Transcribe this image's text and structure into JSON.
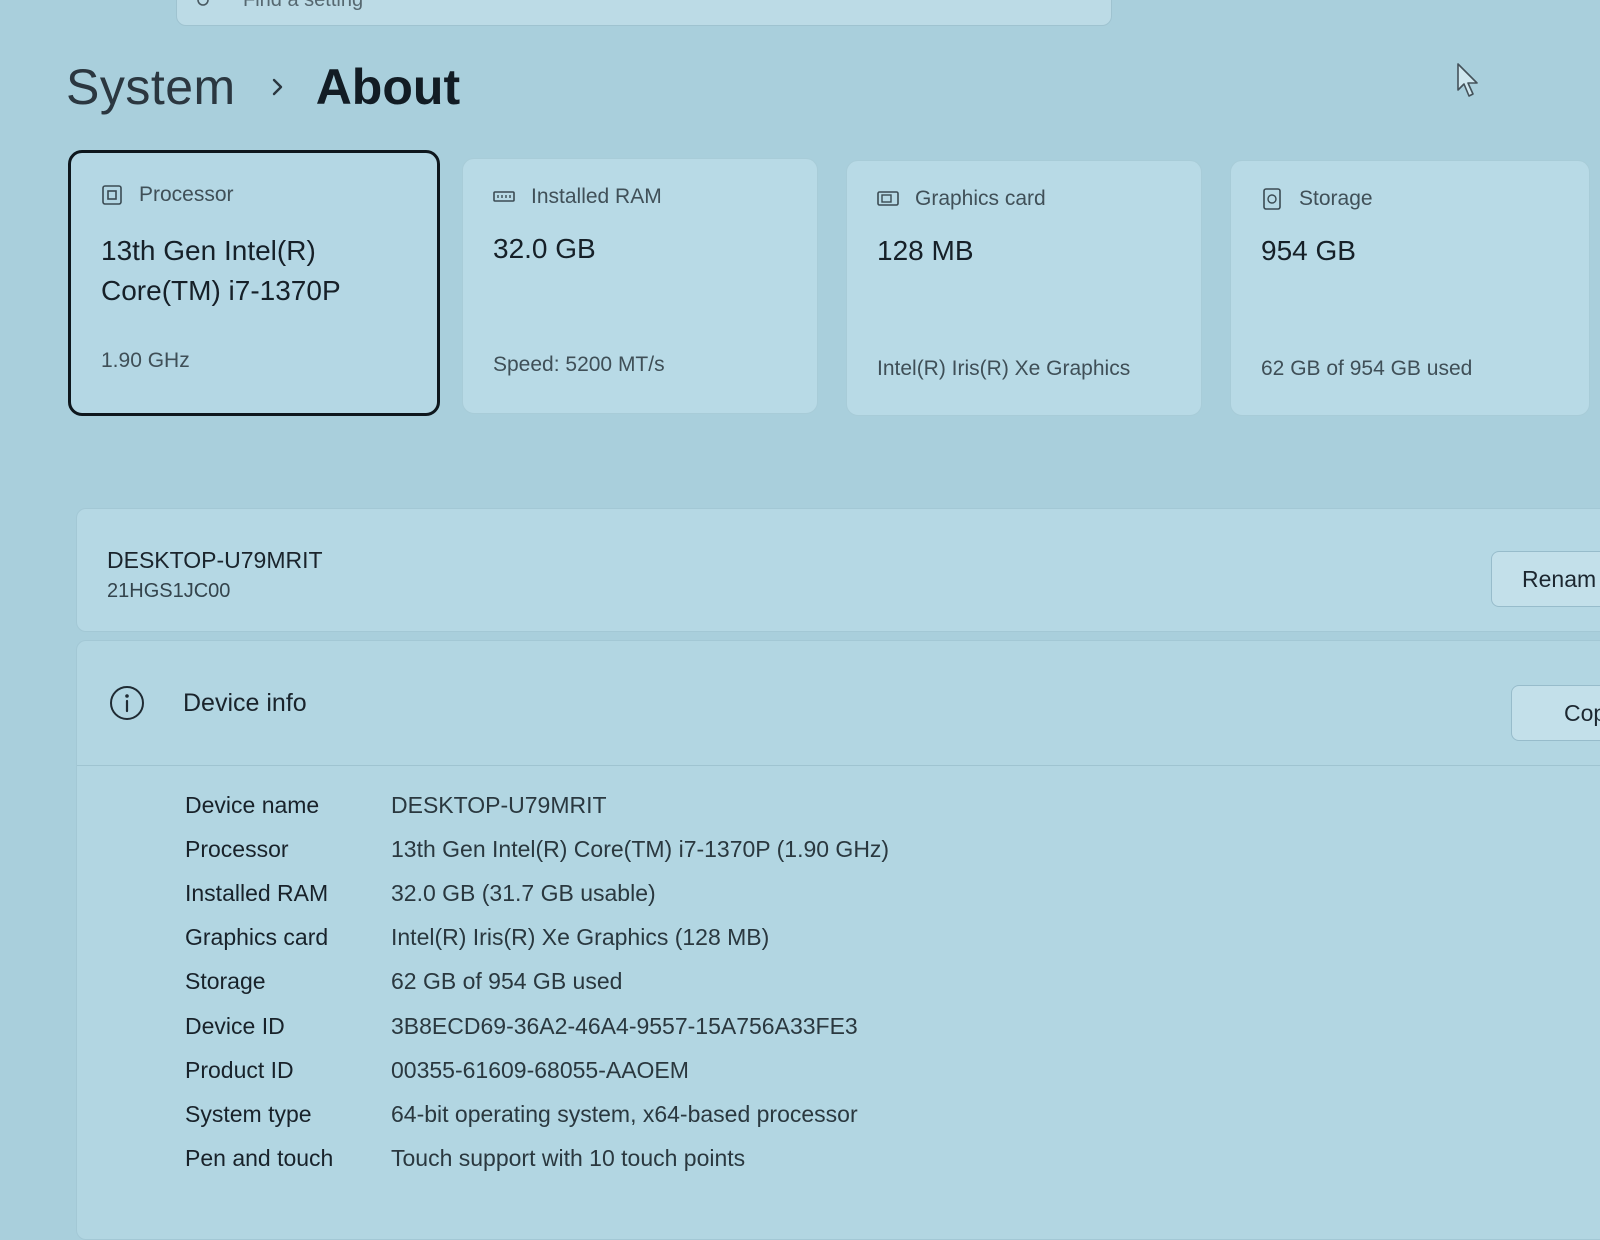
{
  "search": {
    "placeholder": "Find a setting"
  },
  "breadcrumb": {
    "parent": "System",
    "current": "About"
  },
  "cards": [
    {
      "id": "processor",
      "icon": "processor-icon",
      "label": "Processor",
      "value": "13th Gen Intel(R) Core(TM) i7-1370P",
      "sub": "1.90 GHz",
      "selected": true
    },
    {
      "id": "ram",
      "icon": "ram-icon",
      "label": "Installed RAM",
      "value": "32.0 GB",
      "sub": "Speed: 5200 MT/s",
      "selected": false
    },
    {
      "id": "graphics",
      "icon": "graphics-card-icon",
      "label": "Graphics card",
      "value": "128 MB",
      "sub": "Intel(R) Iris(R) Xe Graphics",
      "selected": false
    },
    {
      "id": "storage",
      "icon": "storage-icon",
      "label": "Storage",
      "value": "954 GB",
      "sub": "62 GB of 954 GB used",
      "selected": false
    }
  ],
  "device": {
    "name": "DESKTOP-U79MRIT",
    "model": "21HGS1JC00",
    "rename_label": "Renam"
  },
  "device_info": {
    "title": "Device info",
    "copy_label": "Cop",
    "specs": [
      {
        "key": "Device name",
        "value": "DESKTOP-U79MRIT"
      },
      {
        "key": "Processor",
        "value": "13th Gen Intel(R) Core(TM) i7-1370P (1.90 GHz)"
      },
      {
        "key": "Installed RAM",
        "value": "32.0 GB (31.7 GB usable)"
      },
      {
        "key": "Graphics card",
        "value": "Intel(R) Iris(R) Xe Graphics (128 MB)"
      },
      {
        "key": "Storage",
        "value": "62 GB of 954 GB used"
      },
      {
        "key": "Device ID",
        "value": "3B8ECD69-36A2-46A4-9557-15A756A33FE3"
      },
      {
        "key": "Product ID",
        "value": "00355-61609-68055-AAOEM"
      },
      {
        "key": "System type",
        "value": "64-bit operating system, x64-based processor"
      },
      {
        "key": "Pen and touch",
        "value": "Touch support with 10 touch points"
      }
    ]
  }
}
